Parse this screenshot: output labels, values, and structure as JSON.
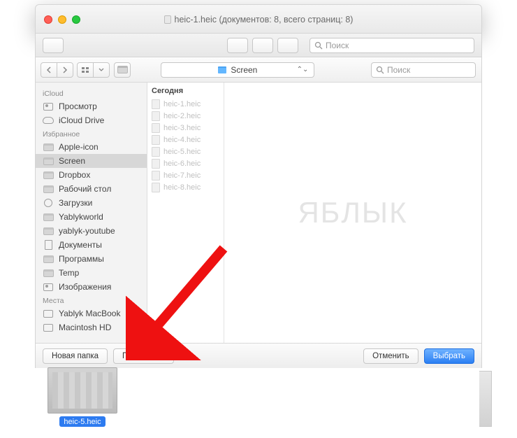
{
  "window": {
    "title": "heic-1.heic (документов: 8, всего страниц: 8)",
    "search_placeholder": "Поиск"
  },
  "picker": {
    "folder": "Screen",
    "search_placeholder": "Поиск",
    "sections": {
      "icloud": {
        "header": "iCloud",
        "items": [
          "Просмотр",
          "iCloud Drive"
        ]
      },
      "fav": {
        "header": "Избранное",
        "items": [
          "Apple-icon",
          "Screen",
          "Dropbox",
          "Рабочий стол",
          "Загрузки",
          "Yablykworld",
          "yablyk-youtube",
          "Документы",
          "Программы",
          "Temp",
          "Изображения"
        ]
      },
      "places": {
        "header": "Места",
        "items": [
          "Yablyk MacBook",
          "Macintosh HD"
        ]
      }
    },
    "list_header": "Сегодня",
    "files": [
      "heic-1.heic",
      "heic-2.heic",
      "heic-3.heic",
      "heic-4.heic",
      "heic-5.heic",
      "heic-6.heic",
      "heic-7.heic",
      "heic-8.heic"
    ],
    "buttons": {
      "new_folder": "Новая папка",
      "options": "Параметры",
      "cancel": "Отменить",
      "choose": "Выбрать"
    }
  },
  "watermark": "ЯБЛЫК",
  "thumbnail": {
    "label": "heic-5.heic"
  }
}
